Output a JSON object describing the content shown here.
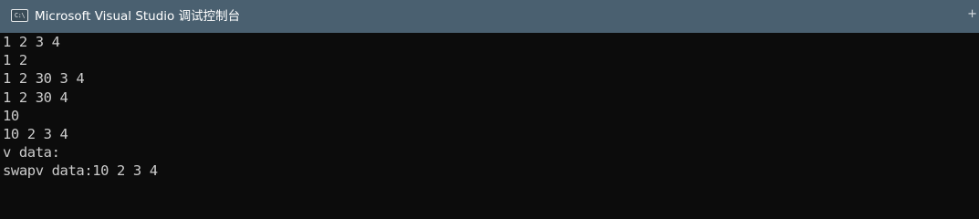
{
  "window": {
    "title": "Microsoft Visual Studio 调试控制台",
    "icon": "console-app-icon",
    "icon_text": "C:\\",
    "new_tab_glyph": "+"
  },
  "colors": {
    "titlebar": "#4a6070",
    "console_bg": "#0c0c0c",
    "console_fg": "#cccccc"
  },
  "console": {
    "lines": [
      "1 2 3 4",
      "1 2",
      "1 2 30 3 4",
      "1 2 30 4",
      "10",
      "10 2 3 4",
      "v data:",
      "swapv data:10 2 3 4"
    ]
  }
}
